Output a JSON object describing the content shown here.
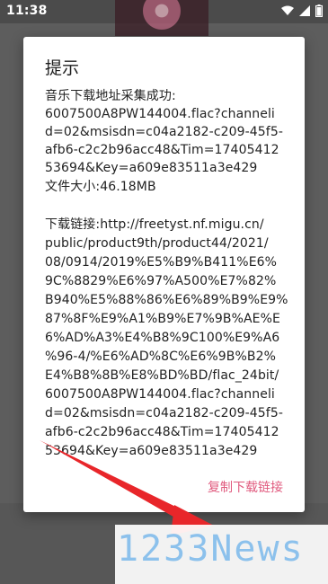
{
  "status": {
    "time": "11:38",
    "icons": [
      "wifi-icon",
      "signal-icon",
      "battery-icon"
    ]
  },
  "dialog": {
    "title": "提示",
    "lines": [
      "音乐下载地址采集成功:",
      "6007500A8PW144004.flac?channeli",
      "d=02&msisdn=c04a2182-c209-45f5-",
      "afb6-c2c2b96acc48&Tim=17405412",
      "53694&Key=a609e83511a3e429",
      "文件大小:46.18MB",
      "",
      "下载链接:http://freetyst.nf.migu.cn/",
      "public/product9th/product44/2021/",
      "08/0914/2019%E5%B9%B411%E6%",
      "9C%8829%E6%97%A500%E7%82%",
      "B940%E5%88%86%E6%89%B9%E9%",
      "87%8F%E9%A1%B9%E7%9B%AE%E",
      "6%AD%A3%E4%B8%9C100%E9%A6",
      "%96-4/%E6%AD%8C%E6%9B%B2%",
      "E4%B8%8B%E8%BD%BD/flac_24bit/",
      "6007500A8PW144004.flac?channeli",
      "d=02&msisdn=c04a2182-c209-45f5-",
      "afb6-c2c2b96acc48&Tim=17405412",
      "53694&Key=a609e83511a3e429"
    ],
    "copy_label": "复制下载链接"
  },
  "watermark": {
    "text": "1233News"
  },
  "colors": {
    "accent": "#e05a7e",
    "arrow": "#e8262a",
    "watermark": "#8cc1ec"
  }
}
